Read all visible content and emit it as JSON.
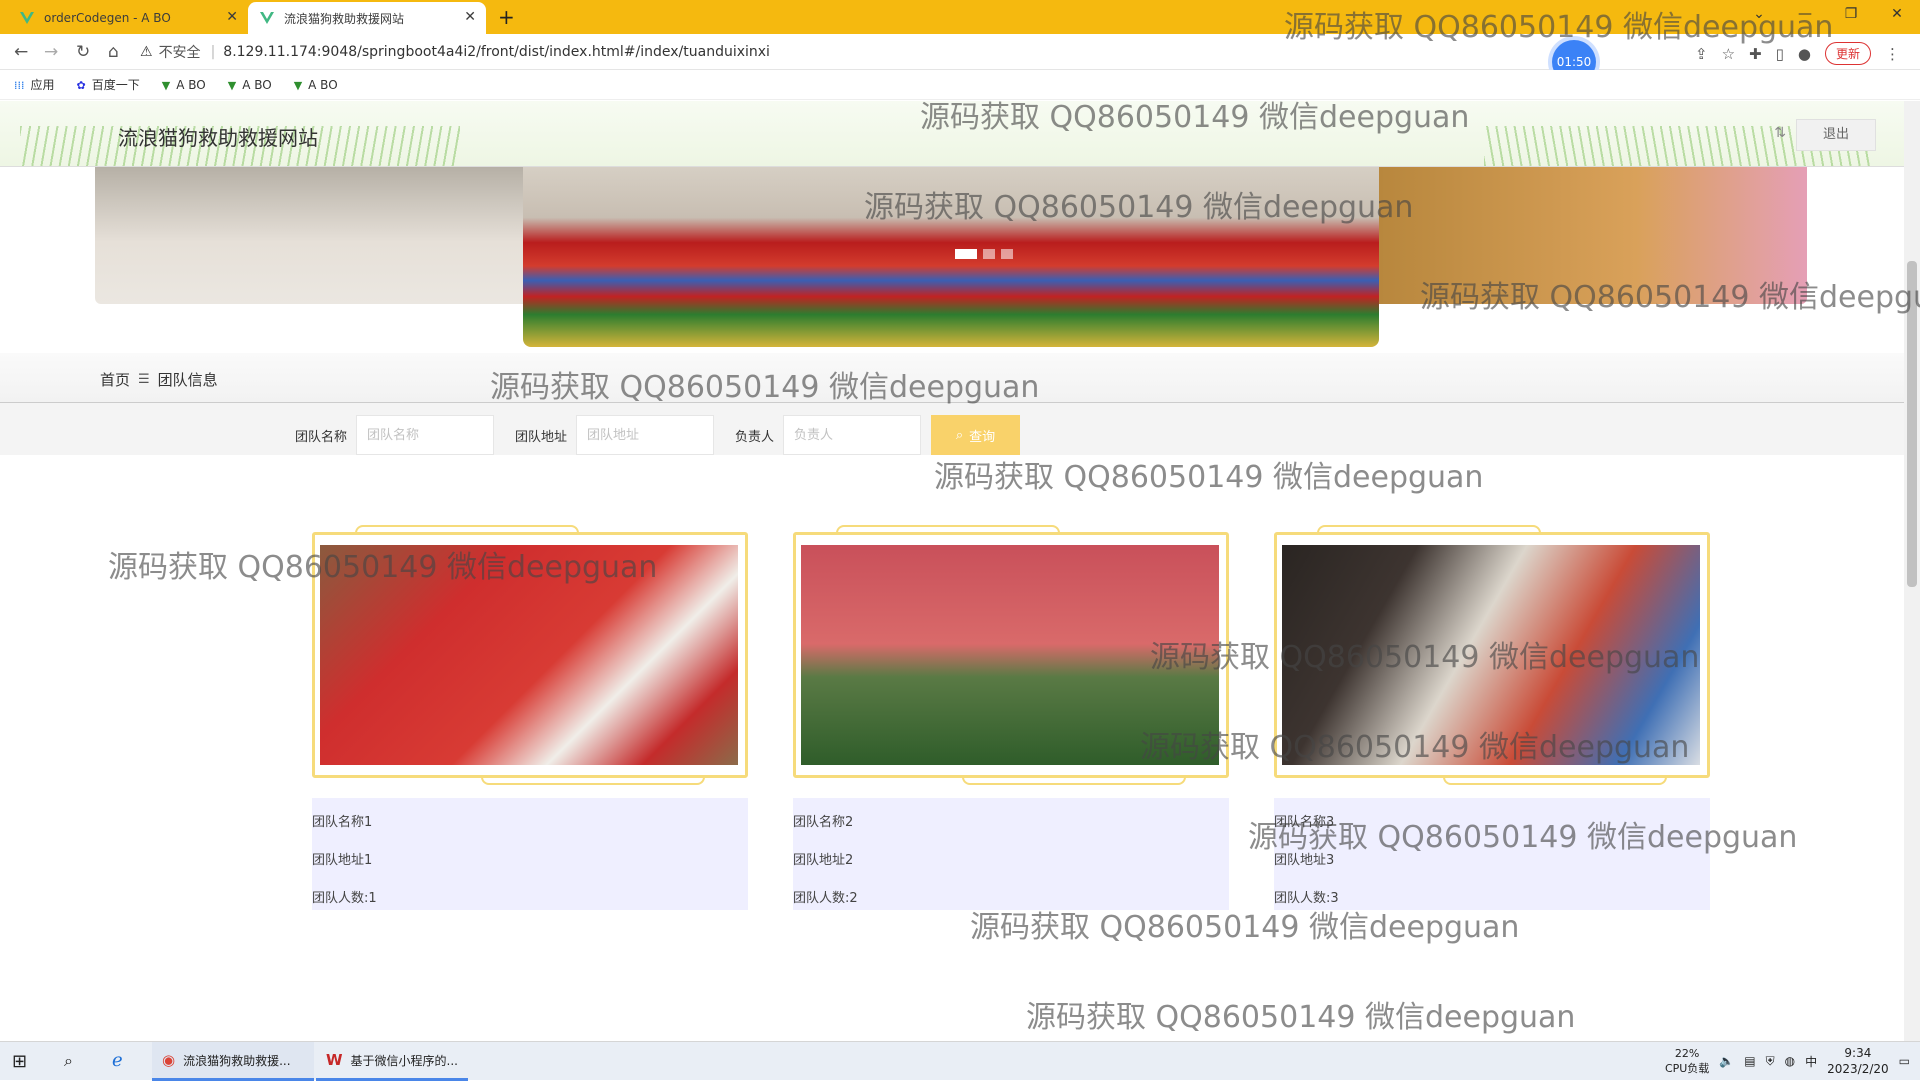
{
  "browser": {
    "tabs": [
      {
        "title": "orderCodegen - A BO",
        "active": false
      },
      {
        "title": "流浪猫狗救助救援网站",
        "active": true
      }
    ],
    "insecure_label": "不安全",
    "url": "8.129.11.174:9048/springboot4a4i2/front/dist/index.html#/index/tuanduixinxi",
    "timer": "01:50",
    "update_label": "更新",
    "bookmarks": [
      "应用",
      "百度一下",
      "A BO",
      "A BO",
      "A BO"
    ]
  },
  "site": {
    "title": "流浪猫狗救助救援网站",
    "logout_label": "退出"
  },
  "carousel": {
    "slide_count": 3,
    "active_index": 0
  },
  "breadcrumb": {
    "home": "首页",
    "separator": "☰",
    "current": "团队信息"
  },
  "search": {
    "fields": [
      {
        "label": "团队名称",
        "placeholder": "团队名称"
      },
      {
        "label": "团队地址",
        "placeholder": "团队地址"
      },
      {
        "label": "负责人",
        "placeholder": "负责人"
      }
    ],
    "button_label": "查询"
  },
  "cards": [
    {
      "name": "团队名称1",
      "address": "团队地址1",
      "count": "团队人数:1"
    },
    {
      "name": "团队名称2",
      "address": "团队地址2",
      "count": "团队人数:2"
    },
    {
      "name": "团队名称3",
      "address": "团队地址3",
      "count": "团队人数:3"
    }
  ],
  "watermark": "源码获取 QQ86050149 微信deepguan",
  "taskbar": {
    "apps": [
      "流浪猫狗救助救援...",
      "基于微信小程序的..."
    ],
    "cpu_percent": "22%",
    "cpu_label": "CPU负载",
    "ime": "中",
    "time": "9:34",
    "date": "2023/2/20"
  }
}
